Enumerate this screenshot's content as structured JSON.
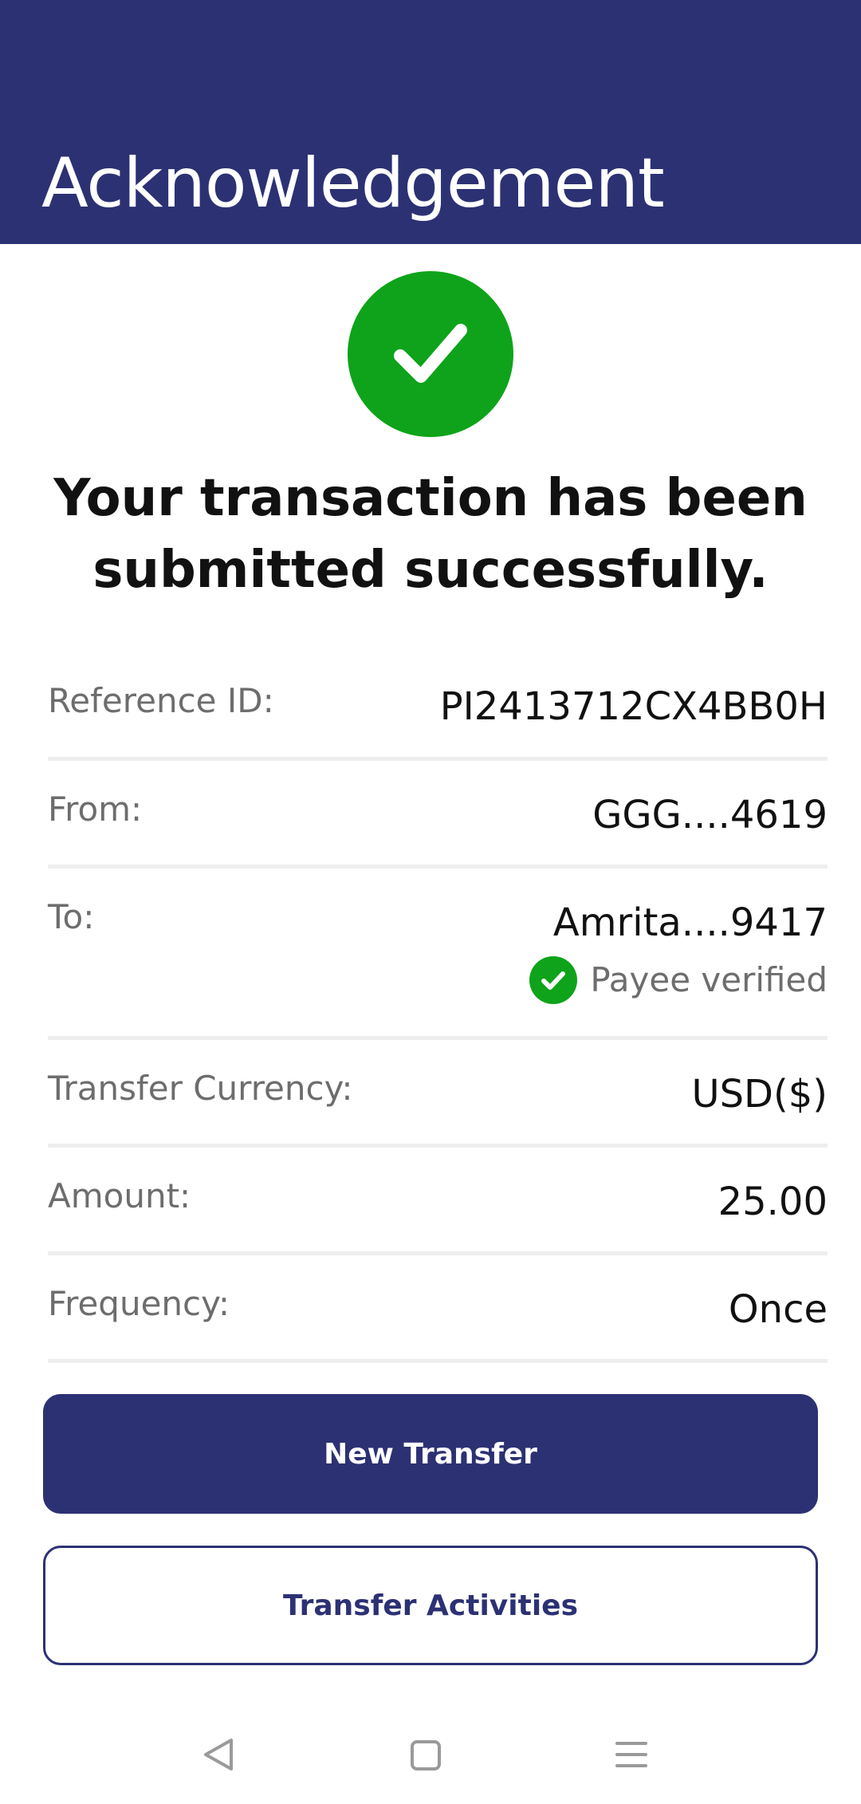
{
  "header": {
    "title": "Acknowledgement"
  },
  "message": {
    "line1": "Your transaction has been",
    "line2": "submitted successfully."
  },
  "details": {
    "reference": {
      "label": "Reference ID:",
      "value": "PI2413712CX4BB0H"
    },
    "from": {
      "label": "From:",
      "value": "GGG....4619"
    },
    "to": {
      "label": "To:",
      "value": "Amrita....9417",
      "verified_text": "Payee verified"
    },
    "currency": {
      "label": "Transfer Currency:",
      "value": "USD($)"
    },
    "amount": {
      "label": "Amount:",
      "value": "25.00"
    },
    "frequency": {
      "label": "Frequency:",
      "value": "Once"
    }
  },
  "buttons": {
    "new_transfer": "New Transfer",
    "transfer_activities": "Transfer Activities"
  },
  "colors": {
    "brand": "#2c3174",
    "success": "#0ea31a"
  },
  "icons": {
    "success": "check-circle-icon",
    "verified": "check-circle-icon",
    "nav_back": "triangle-back-icon",
    "nav_home": "square-home-icon",
    "nav_menu": "menu-lines-icon"
  }
}
